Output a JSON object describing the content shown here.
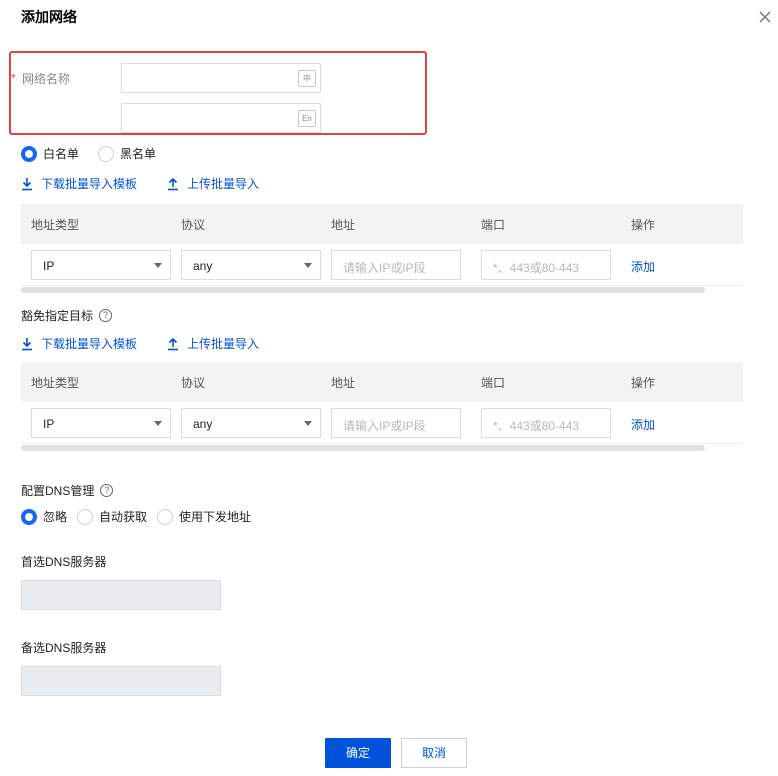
{
  "dialog": {
    "title": "添加网络"
  },
  "name_field": {
    "required_mark": "*",
    "label": "网络名称",
    "cn_tag": "中",
    "en_tag": "En",
    "cn_value": "",
    "en_value": ""
  },
  "list_mode": {
    "options": [
      "白名单",
      "黑名单"
    ],
    "selected": "白名单"
  },
  "links": {
    "download_template": "下载批量导入模板",
    "upload_import": "上传批量导入"
  },
  "table_headers": [
    "地址类型",
    "协议",
    "地址",
    "端口",
    "操作"
  ],
  "rule_row": {
    "addr_type": "IP",
    "protocol": "any",
    "address_placeholder": "请输入IP或IP段",
    "port_placeholder": "*、443或80-443",
    "action": "添加"
  },
  "exempt_section": {
    "label": "豁免指定目标",
    "help": "?",
    "download_template": "下载批量导入模板",
    "upload_import": "上传批量导入",
    "table_headers": [
      "地址类型",
      "协议",
      "地址",
      "端口",
      "操作"
    ],
    "row": {
      "addr_type": "IP",
      "protocol": "any",
      "address_placeholder": "请输入IP或IP段",
      "port_placeholder": "*、443或80-443",
      "action": "添加"
    }
  },
  "dns": {
    "label": "配置DNS管理",
    "help": "?",
    "options": [
      "忽略",
      "自动获取",
      "使用下发地址"
    ],
    "selected": "忽略",
    "primary_label": "首选DNS服务器",
    "secondary_label": "备选DNS服务器",
    "primary_value": "",
    "secondary_value": ""
  },
  "footer": {
    "confirm": "确定",
    "cancel": "取消"
  },
  "colors": {
    "primary": "#0052d9",
    "highlight": "#e5433a",
    "radio_on": "#1664ff"
  }
}
